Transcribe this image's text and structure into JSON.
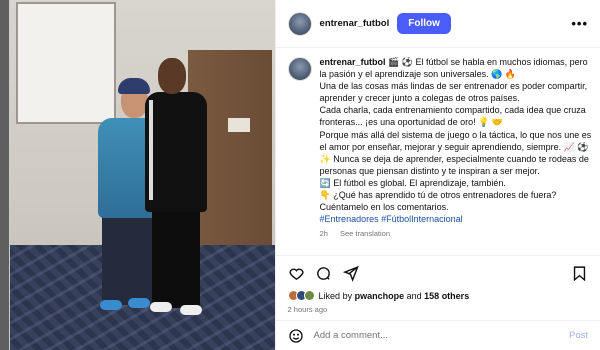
{
  "post": {
    "username": "entrenar_futbol",
    "follow_label": "Follow",
    "more_glyph": "•••",
    "caption_username": "entrenar_futbol",
    "caption_lines": [
      "🎬 ⚽ El fútbol se habla en muchos idiomas, pero la pasión y el aprendizaje son universales. 🌎 🔥",
      "Una de las cosas más lindas de ser entrenador es poder compartir, aprender y crecer junto a colegas de otros países.",
      "Cada charla, cada entrenamiento compartido, cada idea que cruza fronteras... ¡es una oportunidad de oro! 💡 🤝",
      "Porque más allá del sistema de juego o la táctica, lo que nos une es el amor por enseñar, mejorar y seguir aprendiendo, siempre. 📈 ⚽",
      "✨ Nunca se deja de aprender, especialmente cuando te rodeas de personas que piensan distinto y te inspiran a ser mejor.",
      "🔄 El fútbol es global. El aprendizaje, también.",
      "👇 ¿Qué has aprendido tú de otros entrenadores de fuera? Cuéntamelo en los comentarios."
    ],
    "hashtags": "#Entrenadores #FútbolInternacional",
    "caption_time": "2h",
    "see_translation": "See translation",
    "liked_prefix": "Liked by",
    "liked_user": "pwanchope",
    "liked_and": "and",
    "liked_others": "158 others",
    "posted_ago": "2 hours ago",
    "comment_placeholder": "Add a comment...",
    "post_label": "Post"
  },
  "colors": {
    "follow": "#4a5df9",
    "hashtag": "#1b4fa0",
    "post_disabled": "#9db3f4"
  },
  "icons": [
    "more-icon",
    "heart-icon",
    "comment-icon",
    "share-icon",
    "bookmark-icon",
    "emoji-icon"
  ]
}
